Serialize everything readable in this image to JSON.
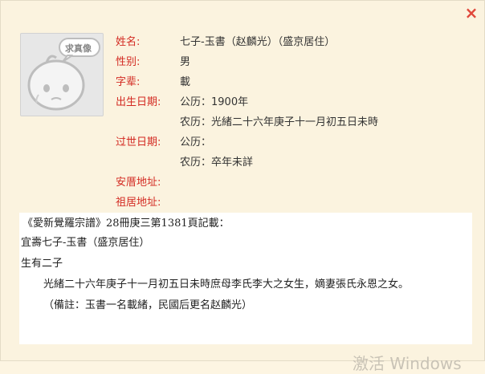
{
  "window": {
    "close_label": "×"
  },
  "avatar": {
    "badge_text": "求真像"
  },
  "profile": {
    "name_label": "姓名:",
    "name_value": "七子-玉書（赵麟光）（盛京居住）",
    "gender_label": "性别:",
    "gender_value": "男",
    "generation_label": "字辈:",
    "generation_value": "載",
    "birth_label": "出生日期:",
    "birth_gregorian": "公历：1900年",
    "birth_lunar": "农历：光緒二十六年庚子十一月初五日未時",
    "death_label": "过世日期:",
    "death_gregorian": "公历：",
    "death_lunar": "农历：卒年未詳",
    "burial_label": "安厝地址:",
    "ancestral_label": "祖居地址:"
  },
  "record": {
    "line1": "《愛新覺羅宗譜》28冊庚三第1381頁記載：",
    "line2": "宜壽七子-玉書（盛京居住）",
    "line3": "生有二子",
    "line4": "光緒二十六年庚子十一月初五日未時庶母李氏李大之女生，嫡妻張氏永恩之女。",
    "line5": "（備註：玉書一名載緒，民國后更名赵麟光）"
  },
  "watermark": {
    "text": "激活 Windows"
  }
}
